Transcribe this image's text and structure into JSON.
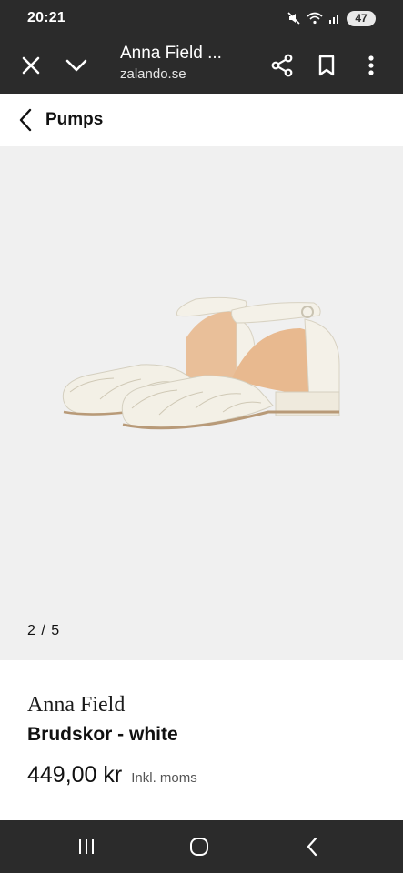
{
  "status_bar": {
    "time": "20:21",
    "icons": [
      "mute-icon",
      "wifi-icon",
      "signal-icon"
    ],
    "battery": "47"
  },
  "browser": {
    "title": "Anna Field ...",
    "url": "zalando.se",
    "icons": {
      "close": "close-icon",
      "minimize": "chevron-down-icon",
      "share": "share-icon",
      "bookmark": "bookmark-icon",
      "menu": "more-vert-icon"
    }
  },
  "page": {
    "title": "Pumps",
    "back_icon": "back-arrow-icon"
  },
  "gallery": {
    "counter": "2 / 5",
    "image_alt": "white lace ankle-strap pumps"
  },
  "product": {
    "brand": "Anna Field",
    "name": "Brudskor - white",
    "price": "449,00 kr",
    "vat_note": "Inkl. moms"
  },
  "nav": {
    "icons": [
      "recent-apps-icon",
      "home-icon",
      "back-icon"
    ]
  },
  "colors": {
    "system_bar": "#2b2b2b",
    "gallery_bg": "#f0f0f0",
    "shoe_white": "#f4f1e8",
    "shoe_lining": "#e8b98f"
  }
}
